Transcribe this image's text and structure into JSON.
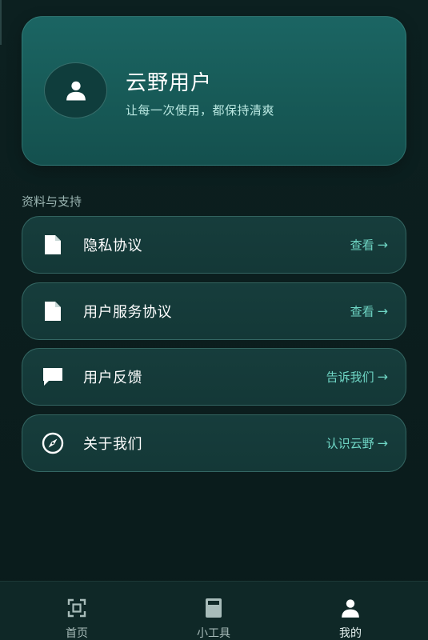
{
  "profile": {
    "name": "云野用户",
    "tagline": "让每一次使用，都保持清爽",
    "avatar_icon": "user-icon"
  },
  "section": {
    "title": "资料与支持"
  },
  "menu": [
    {
      "label": "隐私协议",
      "action": "查看",
      "icon": "document-icon"
    },
    {
      "label": "用户服务协议",
      "action": "查看",
      "icon": "document-icon"
    },
    {
      "label": "用户反馈",
      "action": "告诉我们",
      "icon": "chat-icon"
    },
    {
      "label": "关于我们",
      "action": "认识云野",
      "icon": "compass-icon"
    }
  ],
  "arrow": "→",
  "tabbar": {
    "tabs": [
      {
        "label": "首页",
        "icon": "scan-icon"
      },
      {
        "label": "小工具",
        "icon": "calculator-icon"
      },
      {
        "label": "我的",
        "icon": "user-icon"
      }
    ],
    "active_index": 2
  },
  "colors": {
    "accent": "#6fd6c5",
    "card": "#1b6563",
    "background": "#0a1c1c"
  }
}
